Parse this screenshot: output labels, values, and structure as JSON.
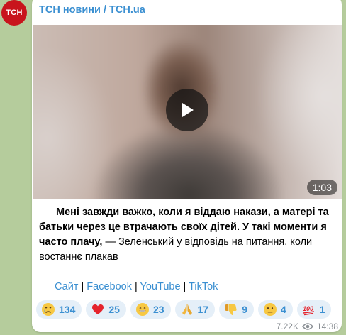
{
  "channel": {
    "avatar_text": "ТСН",
    "name": "ТСН новини / TCH.ua"
  },
  "video": {
    "duration": "1:03"
  },
  "post": {
    "bold_text": "Мені завжди важко, коли я віддаю накази, а матері та батьки через це втрачають своїх дітей. У такі моменти я часто плачу,",
    "regular_text": " — Зеленський у відповідь на питання, коли востаннє плакав"
  },
  "links": [
    {
      "label": "Сайт"
    },
    {
      "label": "Facebook"
    },
    {
      "label": "YouTube"
    },
    {
      "label": "TikTok"
    }
  ],
  "link_separator": " | ",
  "reactions": [
    {
      "icon": "crying-face-icon",
      "count": "134"
    },
    {
      "icon": "red-heart-icon",
      "count": "25"
    },
    {
      "icon": "grinning-face-icon",
      "count": "23"
    },
    {
      "icon": "folded-hands-icon",
      "count": "17"
    },
    {
      "icon": "thumbs-down-icon",
      "count": "9"
    },
    {
      "icon": "neutral-face-icon",
      "count": "4"
    },
    {
      "icon": "hundred-points-icon",
      "count": "1"
    }
  ],
  "meta": {
    "views": "7.22K",
    "time": "14:38"
  },
  "colors": {
    "accent": "#3a8fd1",
    "background": "#b5cc9c",
    "avatar": "#c8141c"
  }
}
